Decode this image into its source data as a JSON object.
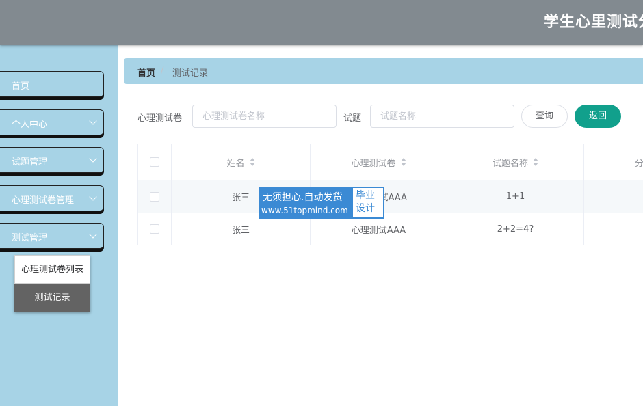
{
  "header": {
    "title": "学生心里测试分"
  },
  "sidebar": {
    "items": [
      {
        "label": "首页",
        "has_chevron": false
      },
      {
        "label": "个人中心",
        "has_chevron": true
      },
      {
        "label": "试题管理",
        "has_chevron": true
      },
      {
        "label": "心理测试卷管理",
        "has_chevron": true
      },
      {
        "label": "测试管理",
        "has_chevron": true
      }
    ],
    "submenu": [
      {
        "label": "心理测试卷列表",
        "active": false
      },
      {
        "label": "测试记录",
        "active": true
      }
    ]
  },
  "breadcrumb": {
    "home": "首页",
    "separator": "/",
    "current": "测试记录"
  },
  "search": {
    "paper_label": "心理测试卷",
    "paper_placeholder": "心理测试卷名称",
    "paper_value": "",
    "question_label": "试题",
    "question_placeholder": "试题名称",
    "question_value": "",
    "query_button": "查询",
    "back_button": "返回"
  },
  "table": {
    "columns": [
      "姓名",
      "心理测试卷",
      "试题名称",
      "分"
    ],
    "rows": [
      {
        "name": "张三",
        "paper": "心理测试卷AAA",
        "question": "1+1"
      },
      {
        "name": "张三",
        "paper": "心理测试AAA",
        "question": "2+2=4?"
      }
    ],
    "row0_paper_visible": "试AAA"
  },
  "watermark": {
    "line1": "无须担心.自动发货",
    "line2": "www.51topmind.com",
    "box_text": "毕业设计"
  },
  "colors": {
    "header_bg": "#828a90",
    "sidebar_bg": "#a7d3e6",
    "accent": "#11a08c",
    "submenu_active_bg": "#636363",
    "watermark_blue": "#3b8ad4"
  }
}
